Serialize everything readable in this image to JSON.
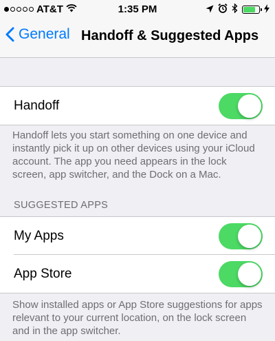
{
  "status_bar": {
    "signal_dots": [
      true,
      false,
      false,
      false,
      false
    ],
    "carrier": "AT&T",
    "time": "1:35 PM",
    "battery_level": 0.8
  },
  "nav": {
    "back_label": "General",
    "title": "Handoff & Suggested Apps"
  },
  "handoff": {
    "label": "Handoff",
    "enabled": true,
    "footer": "Handoff lets you start something on one device and instantly pick it up on other devices using your iCloud account. The app you need appears in the lock screen, app switcher, and the Dock on a Mac."
  },
  "suggested_apps": {
    "header": "SUGGESTED APPS",
    "items": [
      {
        "label": "My Apps",
        "enabled": true
      },
      {
        "label": "App Store",
        "enabled": true
      }
    ],
    "footer": "Show installed apps or App Store suggestions for apps relevant to your current location, on the lock screen and in the app switcher."
  },
  "colors": {
    "accent": "#007aff",
    "toggle_on": "#4cd964",
    "background": "#efeff4"
  }
}
